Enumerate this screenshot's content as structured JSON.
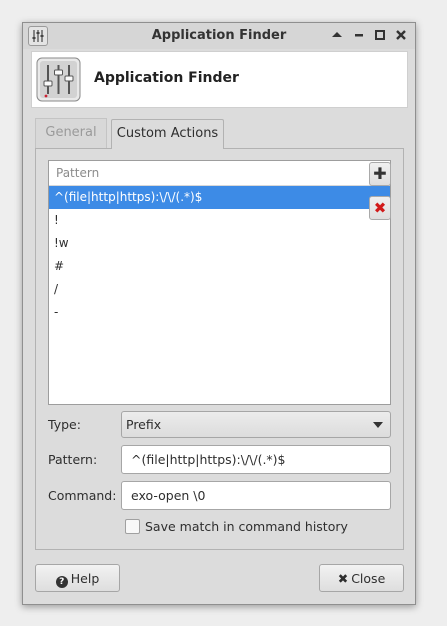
{
  "window": {
    "title": "Application Finder",
    "icons": {
      "app_menu": "mixer-sliders-icon",
      "shade": "shade-up-icon",
      "minimize": "minimize-icon",
      "maximize": "maximize-icon",
      "close": "close-icon"
    }
  },
  "header": {
    "title": "Application Finder",
    "icon": "settings-sliders-icon"
  },
  "tabs": [
    {
      "label": "General",
      "active": false
    },
    {
      "label": "Custom Actions",
      "active": true
    }
  ],
  "actions_list": {
    "column_header": "Pattern",
    "rows": [
      {
        "pattern": "^(file|http|https):\\/\\/(.*)$",
        "selected": true
      },
      {
        "pattern": "!",
        "selected": false
      },
      {
        "pattern": "!w",
        "selected": false
      },
      {
        "pattern": "#",
        "selected": false
      },
      {
        "pattern": "/",
        "selected": false
      },
      {
        "pattern": "-",
        "selected": false
      }
    ],
    "add_icon": "add-icon",
    "remove_icon": "remove-icon"
  },
  "form": {
    "type_label": "Type:",
    "type_value": "Prefix",
    "pattern_label": "Pattern:",
    "pattern_value": "^(file|http|https):\\/\\/(.*)$",
    "command_label": "Command:",
    "command_value": "exo-open \\0",
    "save_history_label": "Save match in command history",
    "save_history_checked": false
  },
  "buttons": {
    "help_label": "Help",
    "close_label": "Close"
  },
  "colors": {
    "selection": "#3d8be6",
    "remove": "#d11a1a",
    "window_bg": "#dcdcdc"
  }
}
